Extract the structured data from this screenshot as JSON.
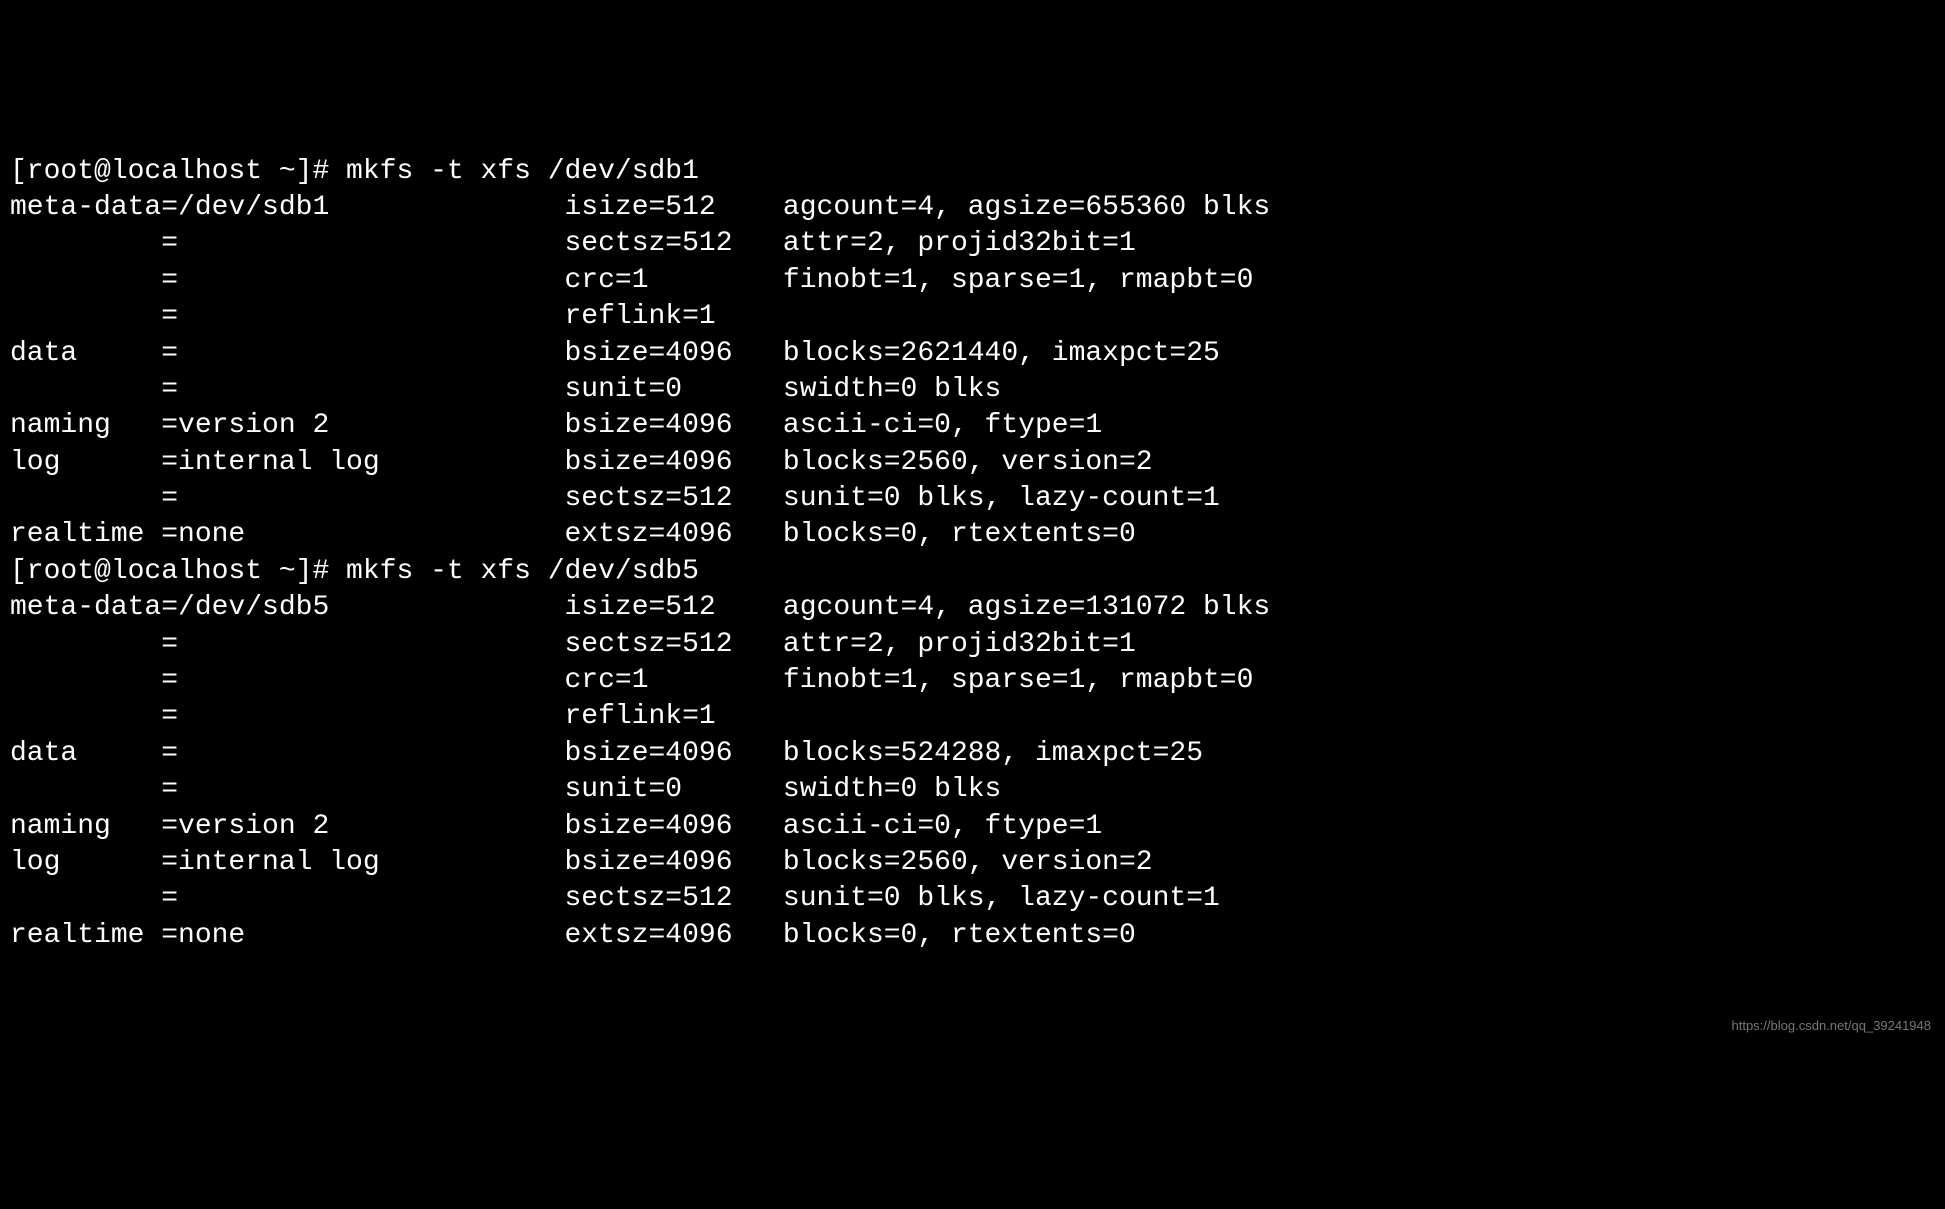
{
  "watermark": "https://blog.csdn.net/qq_39241948",
  "lines": [
    "[root@localhost ~]# mkfs -t xfs /dev/sdb1",
    "meta-data=/dev/sdb1              isize=512    agcount=4, agsize=655360 blks",
    "         =                       sectsz=512   attr=2, projid32bit=1",
    "         =                       crc=1        finobt=1, sparse=1, rmapbt=0",
    "         =                       reflink=1",
    "data     =                       bsize=4096   blocks=2621440, imaxpct=25",
    "         =                       sunit=0      swidth=0 blks",
    "naming   =version 2              bsize=4096   ascii-ci=0, ftype=1",
    "log      =internal log           bsize=4096   blocks=2560, version=2",
    "         =                       sectsz=512   sunit=0 blks, lazy-count=1",
    "realtime =none                   extsz=4096   blocks=0, rtextents=0",
    "[root@localhost ~]# mkfs -t xfs /dev/sdb5",
    "meta-data=/dev/sdb5              isize=512    agcount=4, agsize=131072 blks",
    "         =                       sectsz=512   attr=2, projid32bit=1",
    "         =                       crc=1        finobt=1, sparse=1, rmapbt=0",
    "         =                       reflink=1",
    "data     =                       bsize=4096   blocks=524288, imaxpct=25",
    "         =                       sunit=0      swidth=0 blks",
    "naming   =version 2              bsize=4096   ascii-ci=0, ftype=1",
    "log      =internal log           bsize=4096   blocks=2560, version=2",
    "         =                       sectsz=512   sunit=0 blks, lazy-count=1",
    "realtime =none                   extsz=4096   blocks=0, rtextents=0"
  ]
}
